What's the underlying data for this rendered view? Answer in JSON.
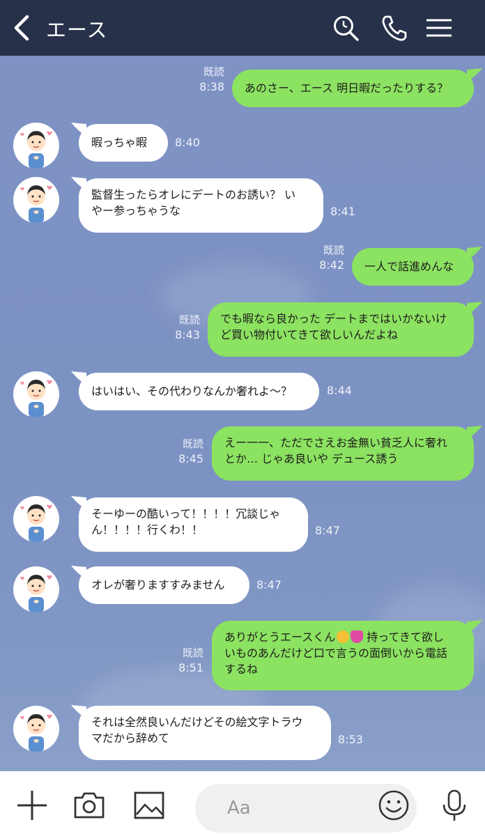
{
  "header": {
    "title": "エース",
    "icons": [
      "back-icon",
      "search-icon",
      "phone-icon",
      "menu-icon"
    ],
    "background": "#273149"
  },
  "colors": {
    "chat_background": "#7b93c2",
    "outgoing_bubble": "#8ce261",
    "incoming_bubble": "#ffffff"
  },
  "messages": [
    {
      "side": "out",
      "read": "既読",
      "time": "8:38",
      "text": "あのさー、エース 明日暇だったりする？"
    },
    {
      "side": "in",
      "time": "8:40",
      "text": "暇っちゃ暇"
    },
    {
      "side": "in",
      "time": "8:41",
      "text": "監督生ったらオレにデートのお誘い？ い\nやー参っちゃうな"
    },
    {
      "side": "out",
      "read": "既読",
      "time": "8:42",
      "text": "一人で話進めんな"
    },
    {
      "side": "out",
      "read": "既読",
      "time": "8:43",
      "text": "でも暇なら良かった デートまではいかないけ\nど買い物付いてきて欲しいんだよね"
    },
    {
      "side": "in",
      "time": "8:44",
      "text": "はいはい、その代わりなんか奢れよ〜？"
    },
    {
      "side": "out",
      "read": "既読",
      "time": "8:45",
      "text": "えー一一、ただでさえお金無い貧乏人に奢れ\nとか… じゃあ良いや デュース誘う"
    },
    {
      "side": "in",
      "time": "8:47",
      "text": "そーゆーの酷いって！！！！冗談じゃ\nん！！！！行くわ！！"
    },
    {
      "side": "in",
      "time": "8:47",
      "text": "オレが奢りますすみません"
    },
    {
      "side": "out",
      "read": "既読",
      "time": "8:51",
      "text_a": "ありがとうエースくん",
      "text_b": " 持ってきて欲し\nいものあんだけど口で言うの面倒いから電話\nするね",
      "emojis": [
        "smiling-face-with-hearts-emoji",
        "sparkling-heart-emoji"
      ]
    },
    {
      "side": "in",
      "time": "8:53",
      "text": "それは全然良いんだけどその絵文字トラウ\nマだから辞めて"
    }
  ],
  "bottom_bar": {
    "placeholder": "Aa",
    "icons": [
      "plus-icon",
      "camera-icon",
      "image-icon",
      "smiley-icon",
      "microphone-icon"
    ]
  }
}
